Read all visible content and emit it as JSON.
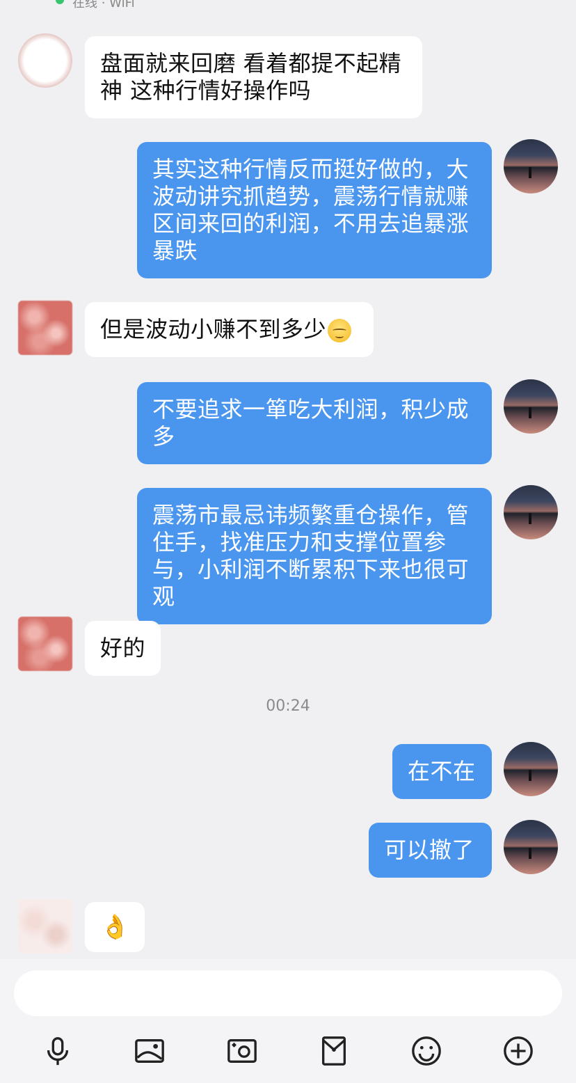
{
  "status": {
    "text": "在线 · WiFi"
  },
  "messages": [
    {
      "side": "in",
      "text": "盘面就来回磨 看着都提不起精神 这种行情好操作吗"
    },
    {
      "side": "out",
      "text": "其实这种行情反而挺好做的，大波动讲究抓趋势，震荡行情就赚区间来回的利润，不用去追暴涨暴跌"
    },
    {
      "side": "in",
      "text": "但是波动小赚不到多少",
      "emoji": "pensive-face"
    },
    {
      "side": "out",
      "text": "不要追求一箪吃大利润，积少成多"
    },
    {
      "side": "out",
      "text": "震荡市最忌讳频繁重仓操作，管住手，找准压力和支撑位置参与，小利润不断累积下来也很可观"
    },
    {
      "side": "in",
      "text": "好的"
    },
    {
      "side": "out",
      "text": "在不在"
    },
    {
      "side": "out",
      "text": "可以撤了"
    },
    {
      "side": "in",
      "text": "👌"
    }
  ],
  "timestamp": "00:24",
  "input": {
    "value": "",
    "placeholder": ""
  },
  "toolbar": {
    "icons": [
      "microphone-icon",
      "image-icon",
      "camera-icon",
      "red-packet-icon",
      "emoji-icon",
      "plus-icon"
    ]
  },
  "colors": {
    "outgoing_bubble": "#4a96ef",
    "incoming_bubble": "#ffffff",
    "background": "#f0f0f2"
  }
}
